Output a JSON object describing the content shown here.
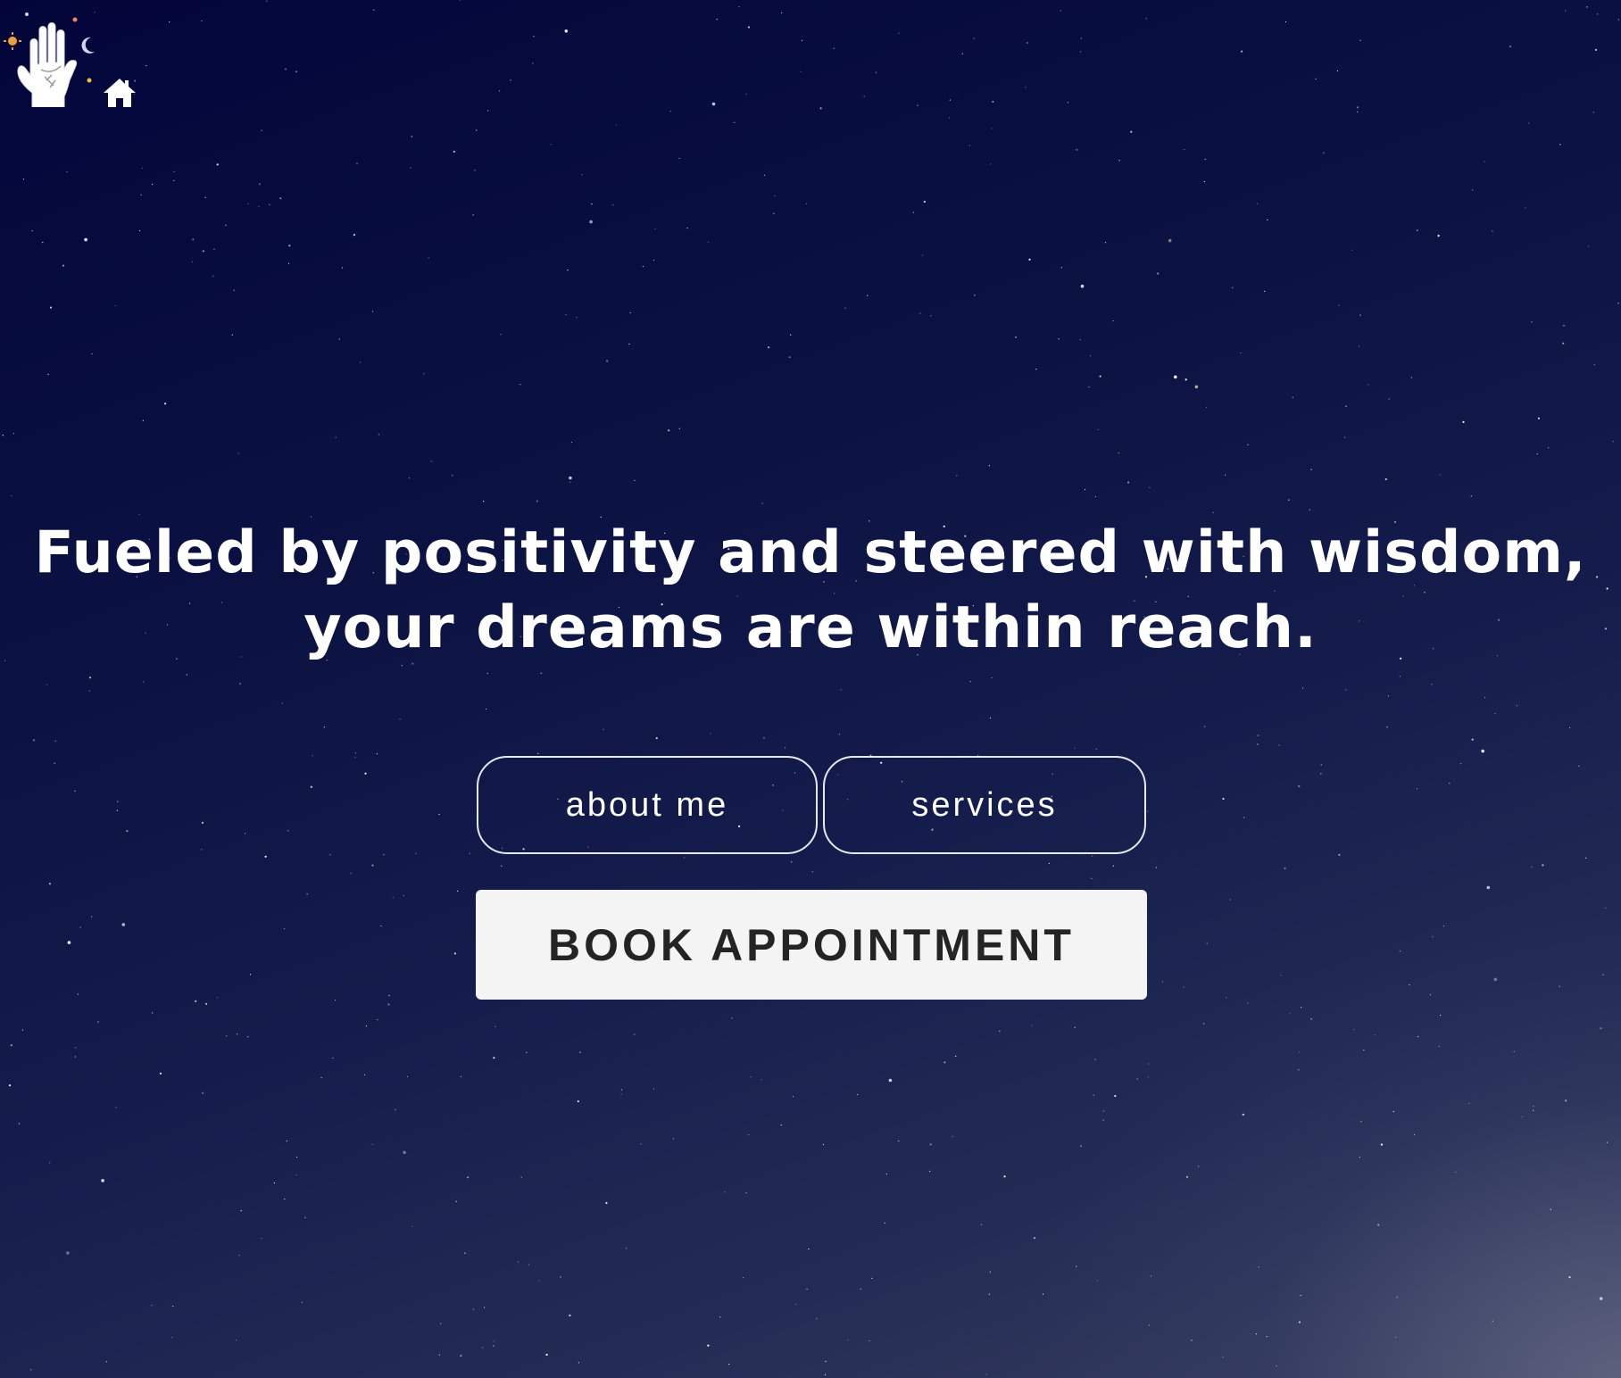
{
  "header": {
    "logo_icon": "palm-hand-sun-moon-icon",
    "home_icon": "home-icon"
  },
  "hero": {
    "headline_line1": "Fueled by positivity and steered with wisdom,",
    "headline_line2": "your dreams are within reach."
  },
  "buttons": {
    "about_label": "about me",
    "services_label": "services",
    "book_label": "BOOK APPOINTMENT"
  },
  "colors": {
    "background_top": "#03053a",
    "background_bottom": "#3a3f5f",
    "text": "#ffffff",
    "book_button_bg": "#f4f4f4",
    "book_button_text": "#242424"
  }
}
